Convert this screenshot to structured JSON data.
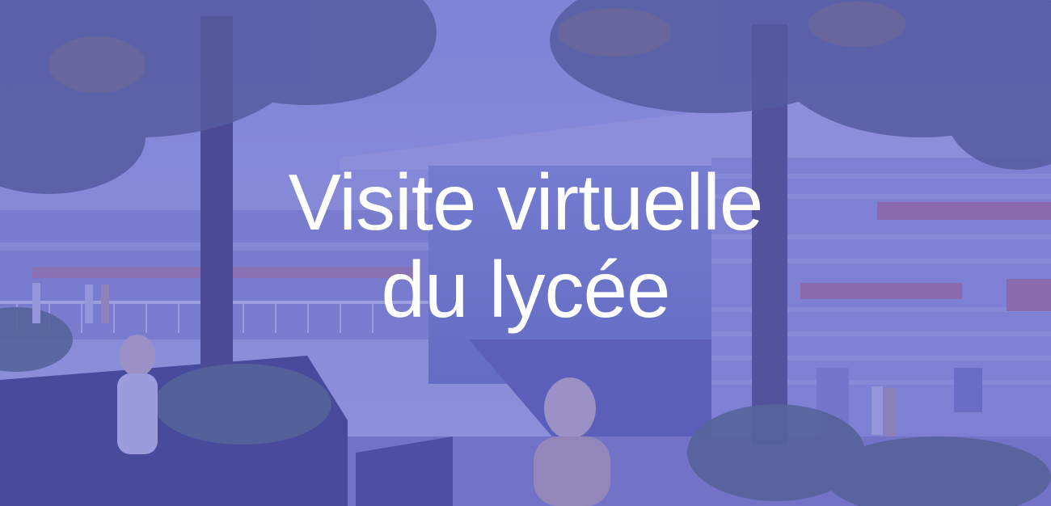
{
  "hero": {
    "title_line1": "Visite virtuelle",
    "title_line2": "du lycée",
    "overlay_color": "#5c5cc8",
    "text_color": "#ffffff",
    "background_image": "school-building-illustration"
  }
}
